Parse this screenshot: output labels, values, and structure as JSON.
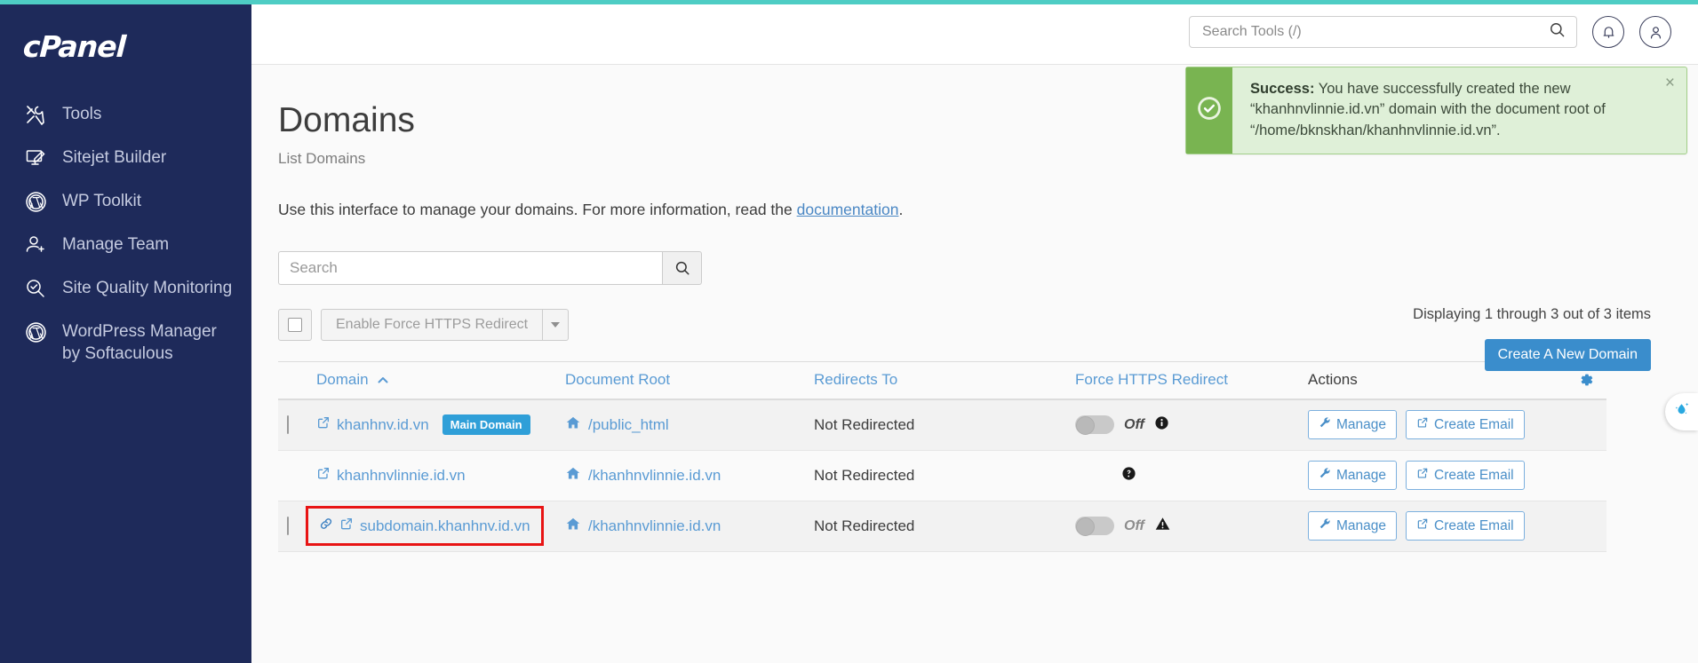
{
  "brand": {
    "logo_text": "cPanel",
    "accent_color": "#4ecdc4",
    "sidebar_color": "#1e2a5a"
  },
  "sidebar": {
    "items": [
      {
        "label": "Tools",
        "icon": "tools-icon"
      },
      {
        "label": "Sitejet Builder",
        "icon": "monitor-pen-icon"
      },
      {
        "label": "WP Toolkit",
        "icon": "wordpress-icon"
      },
      {
        "label": "Manage Team",
        "icon": "users-icon"
      },
      {
        "label": "Site Quality Monitoring",
        "icon": "magnifier-check-icon"
      },
      {
        "label": "WordPress Manager by Softaculous",
        "icon": "wordpress-icon"
      }
    ]
  },
  "topbar": {
    "search_placeholder": "Search Tools (/)",
    "search_value": "",
    "search_icon": "search-icon",
    "notifications_icon": "bell-icon",
    "account_icon": "user-icon"
  },
  "notification": {
    "type": "success",
    "status_icon": "check-circle-icon",
    "label": "Success:",
    "text": " You have successfully created the new “khanhnvlinnie.id.vn” domain with the document root of “/home/bknskhan/khanhnvlinnie.id.vn”.",
    "close_label": "×",
    "bar_color": "#79b451",
    "bg_color": "#dff0d8"
  },
  "page": {
    "title": "Domains",
    "subtitle": "List Domains",
    "intro_text": "Use this interface to manage your domains. For more information, read the ",
    "intro_link": "documentation",
    "intro_end": "."
  },
  "search": {
    "placeholder": "Search",
    "value": "",
    "icon": "search-icon"
  },
  "toolbar": {
    "select_all_label": "select-all-checkbox",
    "https_button_label": "Enable Force HTTPS Redirect",
    "dropdown_icon": "chevron-down-icon"
  },
  "summary": {
    "displaying": "Displaying 1 through 3 out of 3 items"
  },
  "actions": {
    "create_domain_label": "Create A New Domain",
    "create_domain_color": "#3a8dcc"
  },
  "table": {
    "columns": [
      {
        "label": "Domain",
        "sortable": true,
        "sort_icon": "chevron-up-icon"
      },
      {
        "label": "Document Root",
        "sortable": true
      },
      {
        "label": "Redirects To",
        "sortable": true
      },
      {
        "label": "Force HTTPS Redirect",
        "sortable": true
      },
      {
        "label": "Actions",
        "sortable": false
      }
    ],
    "settings_icon": "gear-icon",
    "rows": [
      {
        "checkbox": true,
        "icons": [
          "external-link-icon"
        ],
        "domain": "khanhnv.id.vn",
        "badge": "Main Domain",
        "root_icon": "home-icon",
        "root": "/public_html",
        "redirects_to": "Not Redirected",
        "toggle": true,
        "toggle_state": "Off",
        "status_icon": "info-circle-icon",
        "manage_label": "Manage",
        "manage_icon": "wrench-icon",
        "email_label": "Create Email",
        "email_icon": "external-link-icon",
        "highlighted": false
      },
      {
        "checkbox": false,
        "icons": [
          "external-link-icon"
        ],
        "domain": "khanhnvlinnie.id.vn",
        "badge": "",
        "root_icon": "home-icon",
        "root": "/khanhnvlinnie.id.vn",
        "redirects_to": "Not Redirected",
        "toggle": false,
        "toggle_state": "",
        "status_icon": "question-circle-icon",
        "manage_label": "Manage",
        "manage_icon": "wrench-icon",
        "email_label": "Create Email",
        "email_icon": "external-link-icon",
        "highlighted": false
      },
      {
        "checkbox": true,
        "icons": [
          "link-icon",
          "external-link-icon"
        ],
        "domain": "subdomain.khanhnv.id.vn",
        "badge": "",
        "root_icon": "home-icon",
        "root": "/khanhnvlinnie.id.vn",
        "redirects_to": "Not Redirected",
        "toggle": true,
        "toggle_state": "Off",
        "status_icon": "warning-triangle-icon",
        "manage_label": "Manage",
        "manage_icon": "wrench-icon",
        "email_label": "Create Email",
        "email_icon": "external-link-icon",
        "highlighted": true,
        "highlight_color": "#e81414"
      }
    ]
  },
  "float_widget": {
    "icon": "water-drop-sparkle-icon"
  }
}
